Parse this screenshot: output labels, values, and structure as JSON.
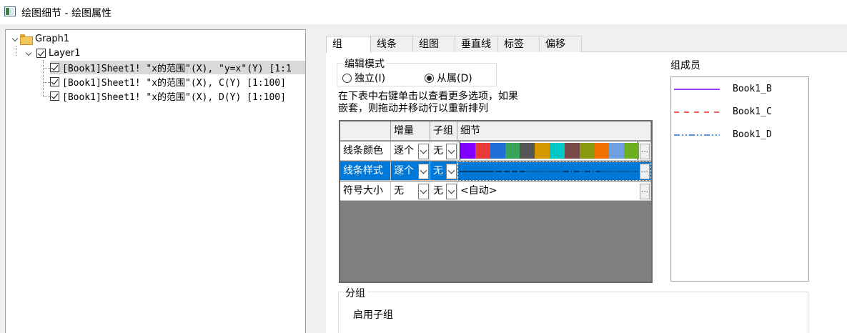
{
  "window": {
    "title": "绘图细节 - 绘图属性"
  },
  "tree": {
    "root": "Graph1",
    "layer": "Layer1",
    "plots": [
      "[Book1]Sheet1! \"x的范围\"(X), \"y=x\"(Y) [1:1",
      "[Book1]Sheet1! \"x的范围\"(X), C(Y) [1:100]",
      "[Book1]Sheet1! \"x的范围\"(X), D(Y) [1:100]"
    ]
  },
  "tabs": [
    "组",
    "线条",
    "组图",
    "垂直线",
    "标签",
    "偏移"
  ],
  "edit_mode": {
    "legend": "编辑模式",
    "options": [
      "独立(I)",
      "从属(D)"
    ],
    "selected": 1
  },
  "instructions": [
    "在下表中右键单击以查看更多选项，如果",
    "嵌套，则拖动并移动行以重新排列"
  ],
  "grid": {
    "headers": [
      "增量",
      "子组",
      "细节"
    ],
    "rows": [
      {
        "name": "线条颜色",
        "increment": "逐个",
        "subgroup": "无",
        "detail": ""
      },
      {
        "name": "线条样式",
        "increment": "逐个",
        "subgroup": "无",
        "detail": ""
      },
      {
        "name": "符号大小",
        "increment": "无",
        "subgroup": "无",
        "detail": "<自动>"
      }
    ],
    "color_swatches": [
      "#8000ff",
      "#e83a3a",
      "#1f6fd6",
      "#3aa35a",
      "#555555",
      "#d29a00",
      "#00c8c8",
      "#7a4a4a",
      "#8a9a10",
      "#f07000",
      "#6ea0e0",
      "#6cb020"
    ],
    "selected_row": 1
  },
  "members": {
    "title": "组成员",
    "items": [
      {
        "name": "Book1_B",
        "color": "#8000ff",
        "style": "solid"
      },
      {
        "name": "Book1_C",
        "color": "#ff2020",
        "style": "dash"
      },
      {
        "name": "Book1_D",
        "color": "#1f6fd6",
        "style": "dashdot"
      }
    ]
  },
  "subgroup": {
    "legend": "分组",
    "enable_label": "启用子组"
  }
}
